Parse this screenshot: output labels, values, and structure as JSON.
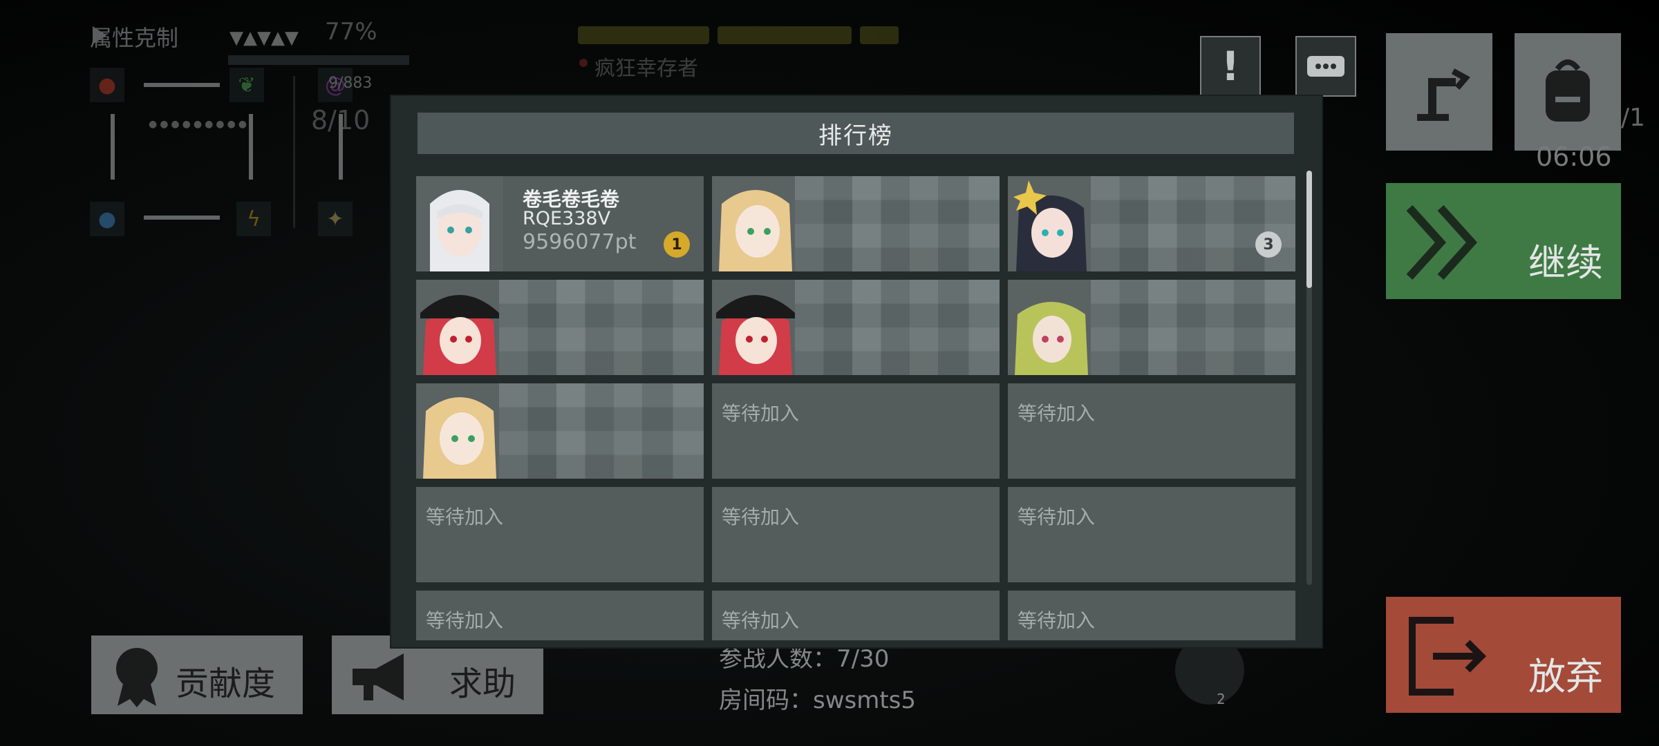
{
  "background": {
    "element_panel": {
      "title": "属性克制",
      "percent": "77%",
      "counter": "9/883",
      "number": "8/10"
    },
    "boss": {
      "name": "疯狂幸存者"
    },
    "participants": "参战人数：7/30",
    "room_code": "房间码：swsmts5",
    "timer": "06:06",
    "page_indicator": "/1",
    "badge_count": "2"
  },
  "right_buttons": {
    "continue_label": "继续",
    "abandon_label": "放弃",
    "crane_icon": "crane-icon",
    "backpack_icon": "backpack-icon"
  },
  "bottom_buttons": {
    "contribution_label": "贡献度",
    "help_label": "求助"
  },
  "top_icons": {
    "alert_icon": "exclamation-icon",
    "chat_icon": "chat-bubble-icon"
  },
  "leaderboard": {
    "title": "排行榜",
    "entries": [
      {
        "name": "卷毛卷毛卷",
        "id": "RQE338V",
        "score": "9596077pt",
        "rank": "1"
      },
      {
        "rank": ""
      },
      {
        "rank": "3"
      },
      {
        "rank": ""
      },
      {
        "rank": ""
      },
      {
        "rank": ""
      },
      {
        "rank": ""
      },
      {
        "wait": "等待加入"
      },
      {
        "wait": "等待加入"
      },
      {
        "wait": "等待加入"
      },
      {
        "wait": "等待加入"
      },
      {
        "wait": "等待加入"
      },
      {
        "wait": "等待加入"
      },
      {
        "wait": "等待加入"
      },
      {
        "wait": "等待加入"
      }
    ]
  },
  "colors": {
    "continue_green": "#3f7a45",
    "abandon_red": "#a34a39",
    "medal_gold": "#d6a92a"
  }
}
